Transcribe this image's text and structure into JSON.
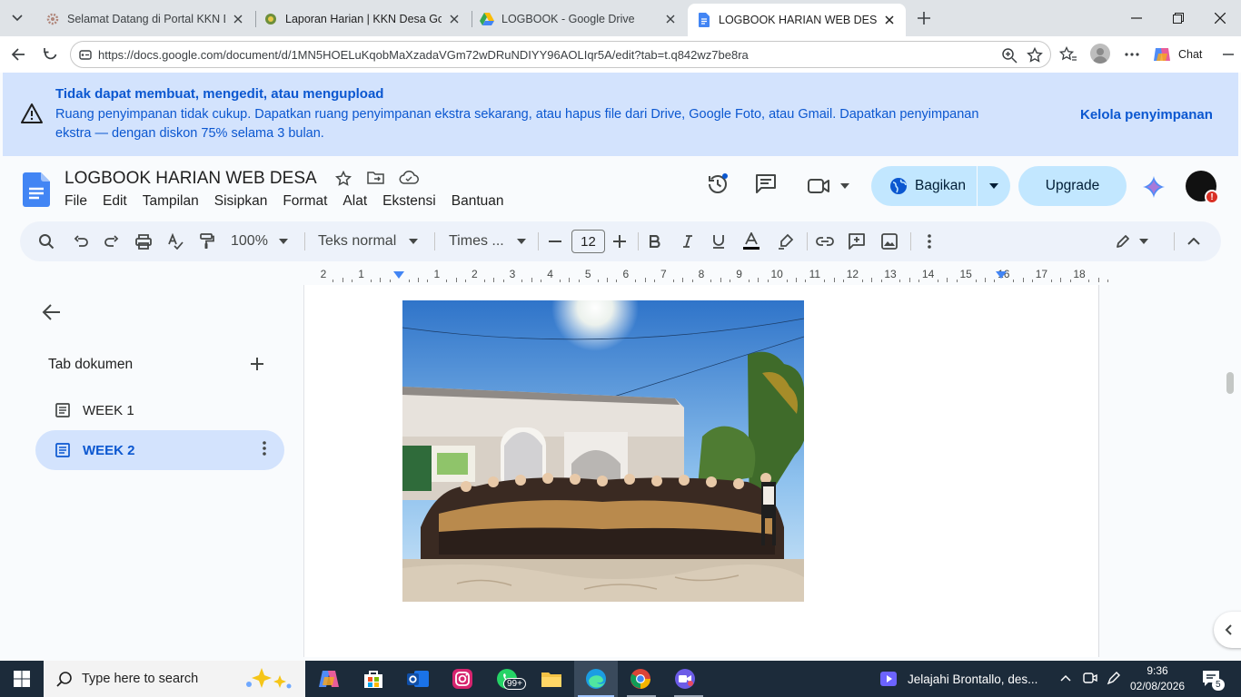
{
  "browser": {
    "tabs": [
      {
        "title": "Selamat Datang di Portal KKN Des",
        "active": false
      },
      {
        "title": "Laporan Harian | KKN Desa Gogik",
        "active": false
      },
      {
        "title": "LOGBOOK - Google Drive",
        "active": false
      },
      {
        "title": "LOGBOOK HARIAN WEB DESA - G",
        "active": true
      }
    ],
    "url": "https://docs.google.com/document/d/1MN5HOELuKqobMaXzadaVGm72wDRuNDIYY96AOLIqr5A/edit?tab=t.q842wz7be8ra",
    "chat_label": "Chat"
  },
  "banner": {
    "title": "Tidak dapat membuat, mengedit, atau mengupload",
    "message": "Ruang penyimpanan tidak cukup. Dapatkan ruang penyimpanan ekstra sekarang, atau hapus file dari Drive, Google Foto, atau Gmail. Dapatkan penyimpanan ekstra — dengan diskon 75% selama 3 bulan.",
    "action": "Kelola penyimpanan"
  },
  "doc": {
    "title": "LOGBOOK HARIAN WEB DESA",
    "menu": [
      "File",
      "Edit",
      "Tampilan",
      "Sisipkan",
      "Format",
      "Alat",
      "Ekstensi",
      "Bantuan"
    ],
    "share_label": "Bagikan",
    "upgrade_label": "Upgrade",
    "avatar_badge": "!"
  },
  "toolbar": {
    "zoom": "100%",
    "style": "Teks normal",
    "font": "Times ...",
    "font_size": "12"
  },
  "ruler": {
    "labels": [
      "2",
      "1",
      "",
      "1",
      "2",
      "3",
      "4",
      "5",
      "6",
      "7",
      "8",
      "9",
      "10",
      "11",
      "12",
      "13",
      "14",
      "15",
      "16",
      "17",
      "18"
    ]
  },
  "sidebar": {
    "title": "Tab dokumen",
    "tabs": [
      {
        "label": "WEEK 1",
        "selected": false
      },
      {
        "label": "WEEK 2",
        "selected": true
      }
    ]
  },
  "taskbar": {
    "search_placeholder": "Type here to search",
    "whatsapp_badge": "99+",
    "news": "Jelajahi Brontallo, des...",
    "time": "9:36",
    "date": "02/08/2026",
    "notifications": "5"
  },
  "colors": {
    "accent": "#0b57d0",
    "banner_bg": "#d3e3fd",
    "share_bg": "#c2e7ff",
    "taskbar_bg": "#1c2b3a"
  }
}
